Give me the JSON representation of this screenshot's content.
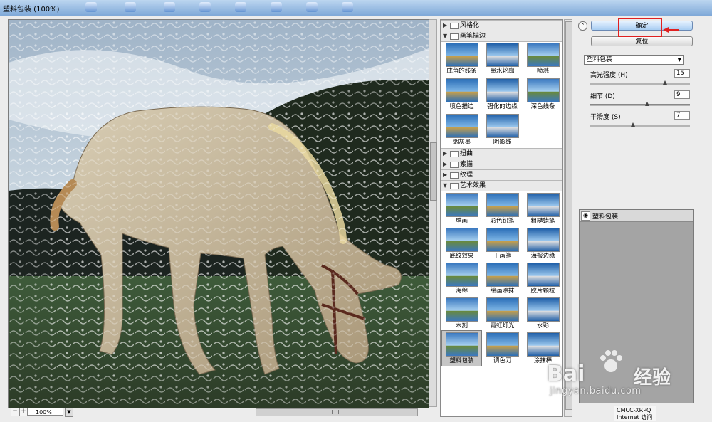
{
  "window": {
    "title": "塑料包装 (100%)"
  },
  "preview": {
    "zoom_text": "100%",
    "zoom_out_symbol": "−",
    "zoom_in_symbol": "+"
  },
  "gallery": {
    "categories": [
      {
        "label": "风格化",
        "expanded": false
      },
      {
        "label": "画笔描边",
        "expanded": true,
        "items": [
          "成角的线条",
          "墨水轮廓",
          "喷溅",
          "喷色描边",
          "强化的边缘",
          "深色线条",
          "烟灰墨",
          "阴影线"
        ]
      },
      {
        "label": "扭曲",
        "expanded": false
      },
      {
        "label": "素描",
        "expanded": false
      },
      {
        "label": "纹理",
        "expanded": false
      },
      {
        "label": "艺术效果",
        "expanded": true,
        "items": [
          "壁画",
          "彩色铅笔",
          "粗糙蜡笔",
          "底纹效果",
          "干画笔",
          "海报边缘",
          "海绵",
          "绘画涂抹",
          "胶片颗粒",
          "木刻",
          "霓虹灯光",
          "水彩",
          "塑料包装",
          "调色刀",
          "涂抹棒"
        ],
        "selected": "塑料包装"
      }
    ]
  },
  "buttons": {
    "ok": "确定",
    "reset": "复位"
  },
  "filter_select": {
    "value": "塑料包装"
  },
  "params": [
    {
      "label": "高光强度 (H)",
      "value": "15",
      "fraction": 0.75
    },
    {
      "label": "细节 (D)",
      "value": "9",
      "fraction": 0.57
    },
    {
      "label": "平滑度 (S)",
      "value": "7",
      "fraction": 0.43
    }
  ],
  "layers": {
    "item": "塑料包装"
  },
  "watermark": {
    "brand": "Bai",
    "brand_cn": "经验",
    "url": "jingyan.baidu.com"
  },
  "tooltip": {
    "line1": "CMCC-XRPQ",
    "line2": "Internet 访问"
  },
  "colors": {
    "highlight": "#e02020",
    "ok_button": "#a9cdf2"
  }
}
